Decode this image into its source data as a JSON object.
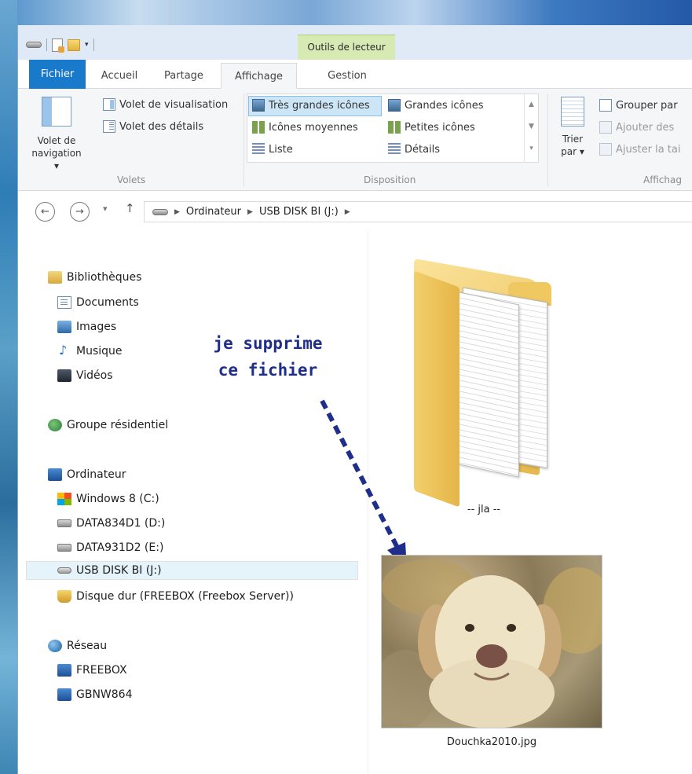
{
  "window": {
    "contextual_tab": "Outils de lecteur"
  },
  "ribbon": {
    "tabs": [
      "Fichier",
      "Accueil",
      "Partage",
      "Affichage",
      "Gestion"
    ],
    "panes": {
      "nav_pane_line1": "Volet de",
      "nav_pane_line2": "navigation ▾",
      "preview": "Volet de visualisation",
      "details": "Volet des détails",
      "group_label": "Volets"
    },
    "layout": {
      "items": [
        "Très grandes icônes",
        "Grandes icônes",
        "Icônes moyennes",
        "Petites icônes",
        "Liste",
        "Détails"
      ],
      "selected": "Très grandes icônes",
      "group_label": "Disposition"
    },
    "current_view": {
      "sort_line1": "Trier",
      "sort_line2": "par ▾",
      "group_by": "Grouper par",
      "add_columns": "Ajouter des",
      "fit_columns": "Ajuster la tai",
      "group_label": "Affichag"
    }
  },
  "address": {
    "breadcrumb": [
      "Ordinateur",
      "USB DISK BI (J:)"
    ]
  },
  "nav_pane": {
    "items": [
      {
        "label": "Bibliothèques",
        "icon": "libraries-icon"
      },
      {
        "label": "Documents",
        "icon": "documents-icon"
      },
      {
        "label": "Images",
        "icon": "images-icon"
      },
      {
        "label": "Musique",
        "icon": "music-icon"
      },
      {
        "label": "Vidéos",
        "icon": "videos-icon"
      },
      {
        "label": "Groupe résidentiel",
        "icon": "homegroup-icon"
      },
      {
        "label": "Ordinateur",
        "icon": "computer-icon"
      },
      {
        "label": "Windows 8 (C:)",
        "icon": "windows-drive-icon"
      },
      {
        "label": "DATA834D1 (D:)",
        "icon": "hard-drive-icon"
      },
      {
        "label": "DATA931D2 (E:)",
        "icon": "hard-drive-icon"
      },
      {
        "label": "USB DISK BI (J:)",
        "icon": "usb-drive-icon"
      },
      {
        "label": "Disque dur (FREEBOX (Freebox Server))",
        "icon": "network-disk-icon"
      },
      {
        "label": "Réseau",
        "icon": "network-icon"
      },
      {
        "label": "FREEBOX",
        "icon": "computer-icon"
      },
      {
        "label": "GBNW864",
        "icon": "computer-icon"
      }
    ],
    "selected": "USB DISK BI (J:)"
  },
  "content": {
    "folder_name": "-- jla --",
    "file_name": "Douchka2010.jpg",
    "annotation_line1": "je supprime",
    "annotation_line2": "ce fichier",
    "annotation_color": "#1f2e8a"
  }
}
